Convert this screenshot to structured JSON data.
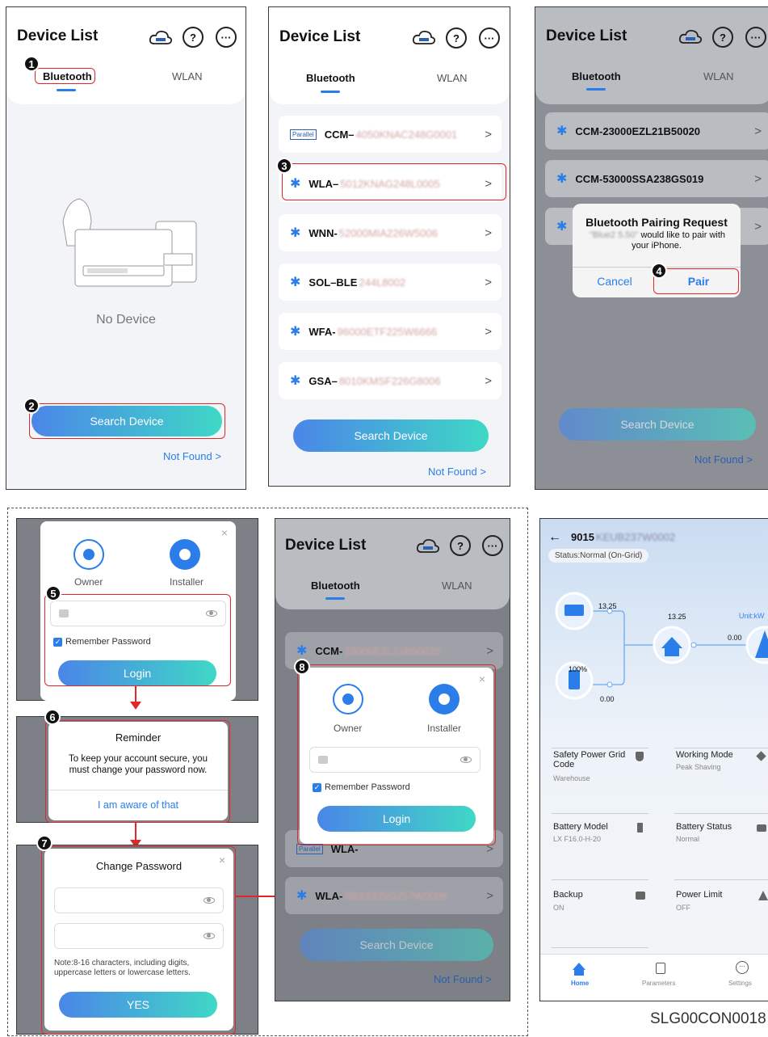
{
  "panel1": {
    "title": "Device List",
    "tab_bluetooth": "Bluetooth",
    "tab_wlan": "WLAN",
    "empty_text": "No Device",
    "search_button": "Search Device",
    "not_found": "Not Found >",
    "step1": "1",
    "step2": "2"
  },
  "panel2": {
    "title": "Device List",
    "tab_bluetooth": "Bluetooth",
    "tab_wlan": "WLAN",
    "devices": [
      {
        "prefix": "CCM–",
        "serial": "4050KNAC248G0001"
      },
      {
        "prefix": "WLA–",
        "serial": "5012KNAG248L0005"
      },
      {
        "prefix": "WNN-",
        "serial": "52000MIA226W5006"
      },
      {
        "prefix": "SOL–BLE",
        "serial": "244L8002"
      },
      {
        "prefix": "WFA-",
        "serial": "96000ETF225W6666"
      },
      {
        "prefix": "GSA–",
        "serial": "8010KMSF226G8006"
      }
    ],
    "search_button": "Search Device",
    "not_found": "Not Found >",
    "step3": "3"
  },
  "panel3": {
    "title": "Device List",
    "tab_bluetooth": "Bluetooth",
    "tab_wlan": "WLAN",
    "devices": [
      "CCM-23000EZL21B50020",
      "CCM-53000SSA238GS019"
    ],
    "dialog_title": "Bluetooth Pairing Request",
    "dialog_blur": "\"Blue2 5.50\"",
    "dialog_msg": "would like to pair with your iPhone.",
    "cancel": "Cancel",
    "pair": "Pair",
    "search_button": "Search Device",
    "not_found": "Not Found >",
    "step4": "4"
  },
  "login": {
    "owner": "Owner",
    "installer": "Installer",
    "remember": "Remember Password",
    "login_button": "Login",
    "step5": "5"
  },
  "reminder": {
    "title": "Reminder",
    "message": "To keep your account secure, you must change your password  now.",
    "ack": "I am aware of that",
    "step6": "6"
  },
  "change_pw": {
    "title": "Change Password",
    "note": "Note:8-16 characters, including digits, uppercase letters or lowercase letters.",
    "yes": "YES",
    "step7": "7"
  },
  "panel5": {
    "title": "Device List",
    "tab_bluetooth": "Bluetooth",
    "tab_wlan": "WLAN",
    "row1_prefix": "CCM-",
    "row1_serial": "23000EZL21B50020",
    "row2_prefix": "WLA-",
    "row2_serial": "58000DSG257W0006",
    "row_hidden_prefix": "WLA-",
    "owner": "Owner",
    "installer": "Installer",
    "remember": "Remember Password",
    "login_button": "Login",
    "search_button": "Search Device",
    "not_found": "Not Found >",
    "step8": "8"
  },
  "home": {
    "device_id_prefix": "9015",
    "device_id_blur": "KEUB237W0002",
    "status": "Status:Normal (On-Grid)",
    "unit": "Unit:kW",
    "pv_value": "13.25",
    "home_value": "13.25",
    "grid_value": "0.00",
    "battery_soc": "100%",
    "battery_value": "0.00",
    "cards": [
      {
        "label": "Safety Power Grid Code",
        "value": "Warehouse"
      },
      {
        "label": "Working Mode",
        "value": "Peak Shaving"
      },
      {
        "label": "Battery Model",
        "value": "LX F16.0-H-20"
      },
      {
        "label": "Battery Status",
        "value": "Normal"
      },
      {
        "label": "Backup",
        "value": "ON"
      },
      {
        "label": "Power Limit",
        "value": "OFF"
      }
    ],
    "nav_home": "Home",
    "nav_parameters": "Parameters",
    "nav_settings": "Settings"
  },
  "code": "SLG00CON0018"
}
